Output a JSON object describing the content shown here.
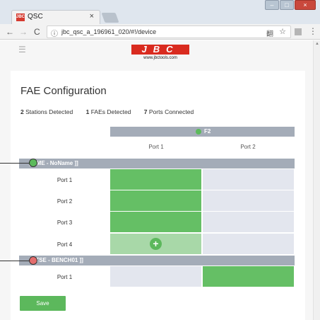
{
  "browser": {
    "tab_title": "QSC",
    "tab_favicon_text": "JBC",
    "tab_close": "×",
    "address": "jbc_qsc_a_196961_020/#!/device",
    "window_buttons": [
      "–",
      "□",
      "×"
    ],
    "nav": {
      "back": "←",
      "forward": "→",
      "reload": "C",
      "info": "ⓘ",
      "star": "☆",
      "translate": "翻",
      "menu": "⋮"
    }
  },
  "app": {
    "hamburger": "☰",
    "logo_text": "JBC",
    "logo_sub": "www.jbctools.com",
    "panel_title": "FAE Configuration",
    "stats": [
      {
        "count": "2",
        "label": "Stations Detected"
      },
      {
        "count": "1",
        "label": "FAEs Detected"
      },
      {
        "count": "7",
        "label": "Ports Connected"
      }
    ],
    "fae_label": "F2",
    "columns": [
      "Port 1",
      "Port 2"
    ],
    "groups": [
      {
        "name": "[ DME - NoName ]]",
        "rows": [
          {
            "label": "Port 1",
            "cells": [
              "on",
              "off"
            ]
          },
          {
            "label": "Port 2",
            "cells": [
              "on",
              "off"
            ]
          },
          {
            "label": "Port 3",
            "cells": [
              "on",
              "off"
            ]
          },
          {
            "label": "Port 4",
            "cells": [
              "hint",
              "off"
            ]
          }
        ]
      },
      {
        "name": "[ JTSE - BENCH01 ]]",
        "rows": [
          {
            "label": "Port 1",
            "cells": [
              "off",
              "on"
            ]
          }
        ]
      }
    ],
    "plus_symbol": "+",
    "save_label": "Save"
  },
  "colors": {
    "assigned": "#65bf65",
    "unassigned": "#e3e6ee",
    "bar": "#a4acb8",
    "callout_green": "#5cba5c",
    "callout_red": "#e36d6d"
  }
}
